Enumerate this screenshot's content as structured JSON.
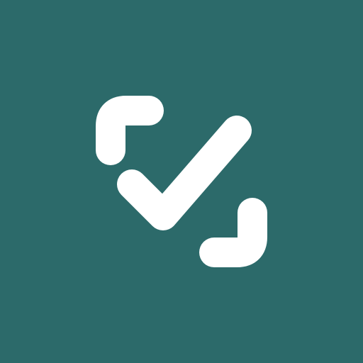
{
  "icon": {
    "semantic": "check-scan-icon",
    "background_color": "#2c6a6a",
    "foreground_color": "#ffffff"
  }
}
